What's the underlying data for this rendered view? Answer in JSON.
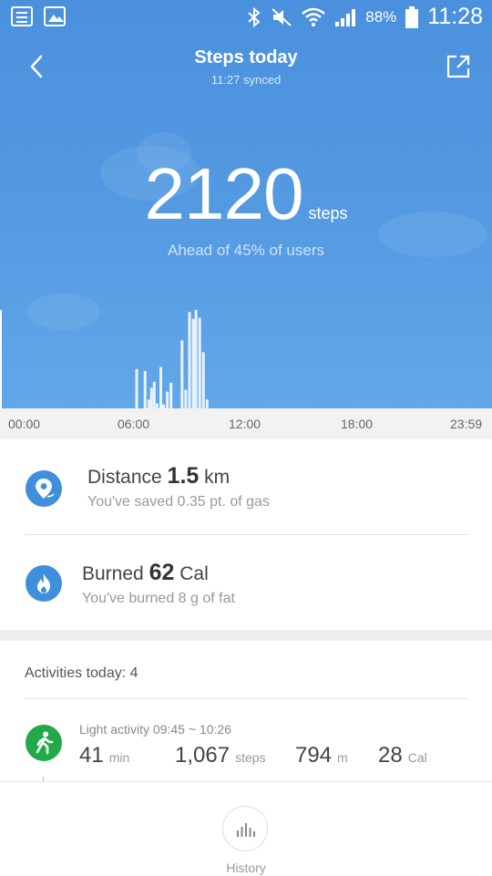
{
  "status_bar": {
    "battery": "88%",
    "time": "11:28"
  },
  "header": {
    "title": "Steps today",
    "sync_status": "11:27 synced"
  },
  "summary": {
    "steps_value": "2120",
    "steps_unit": "steps",
    "ranking_text": "Ahead of 45% of users"
  },
  "chart_data": {
    "type": "bar",
    "x_ticks": [
      "00:00",
      "06:00",
      "12:00",
      "18:00",
      "23:59"
    ],
    "x_range_hours": [
      0,
      24
    ],
    "bars": [
      {
        "hour": 6.1,
        "value": 0.4
      },
      {
        "hour": 6.55,
        "value": 0.38
      },
      {
        "hour": 6.75,
        "value": 0.09
      },
      {
        "hour": 6.9,
        "value": 0.21
      },
      {
        "hour": 7.05,
        "value": 0.27
      },
      {
        "hour": 7.2,
        "value": 0.05
      },
      {
        "hour": 7.4,
        "value": 0.42
      },
      {
        "hour": 7.55,
        "value": 0.04
      },
      {
        "hour": 7.75,
        "value": 0.17
      },
      {
        "hour": 7.95,
        "value": 0.26
      },
      {
        "hour": 8.55,
        "value": 0.69
      },
      {
        "hour": 8.75,
        "value": 0.19
      },
      {
        "hour": 8.95,
        "value": 0.98
      },
      {
        "hour": 9.15,
        "value": 0.91
      },
      {
        "hour": 9.3,
        "value": 1.0
      },
      {
        "hour": 9.5,
        "value": 0.92
      },
      {
        "hour": 9.7,
        "value": 0.57
      },
      {
        "hour": 9.9,
        "value": 0.09
      }
    ],
    "colors": {
      "bar": "#eaf3ff",
      "axis_line": "#ffffff"
    }
  },
  "stats": {
    "distance": {
      "label": "Distance",
      "value": "1.5",
      "unit": "km",
      "detail": "You've saved 0.35 pt. of gas",
      "icon": "location-pin-icon"
    },
    "burned": {
      "label": "Burned",
      "value": "62",
      "unit": "Cal",
      "detail": "You've burned 8 g of fat",
      "icon": "flame-icon"
    }
  },
  "activities": {
    "header": "Activities today:  4",
    "items": [
      {
        "title": "Light activity 09:45 ~ 10:26",
        "duration": "41",
        "duration_unit": "min",
        "steps": "1,067",
        "steps_unit": "steps",
        "distance": "794",
        "distance_unit": "m",
        "calories": "28",
        "calories_unit": "Cal",
        "icon": "walking-person-icon"
      }
    ]
  },
  "bottom_nav": {
    "history_label": "History"
  },
  "colors": {
    "header_blue": "#4a90dd",
    "stat_icon_blue": "#3f8fdc",
    "activity_green": "#22a94a"
  }
}
